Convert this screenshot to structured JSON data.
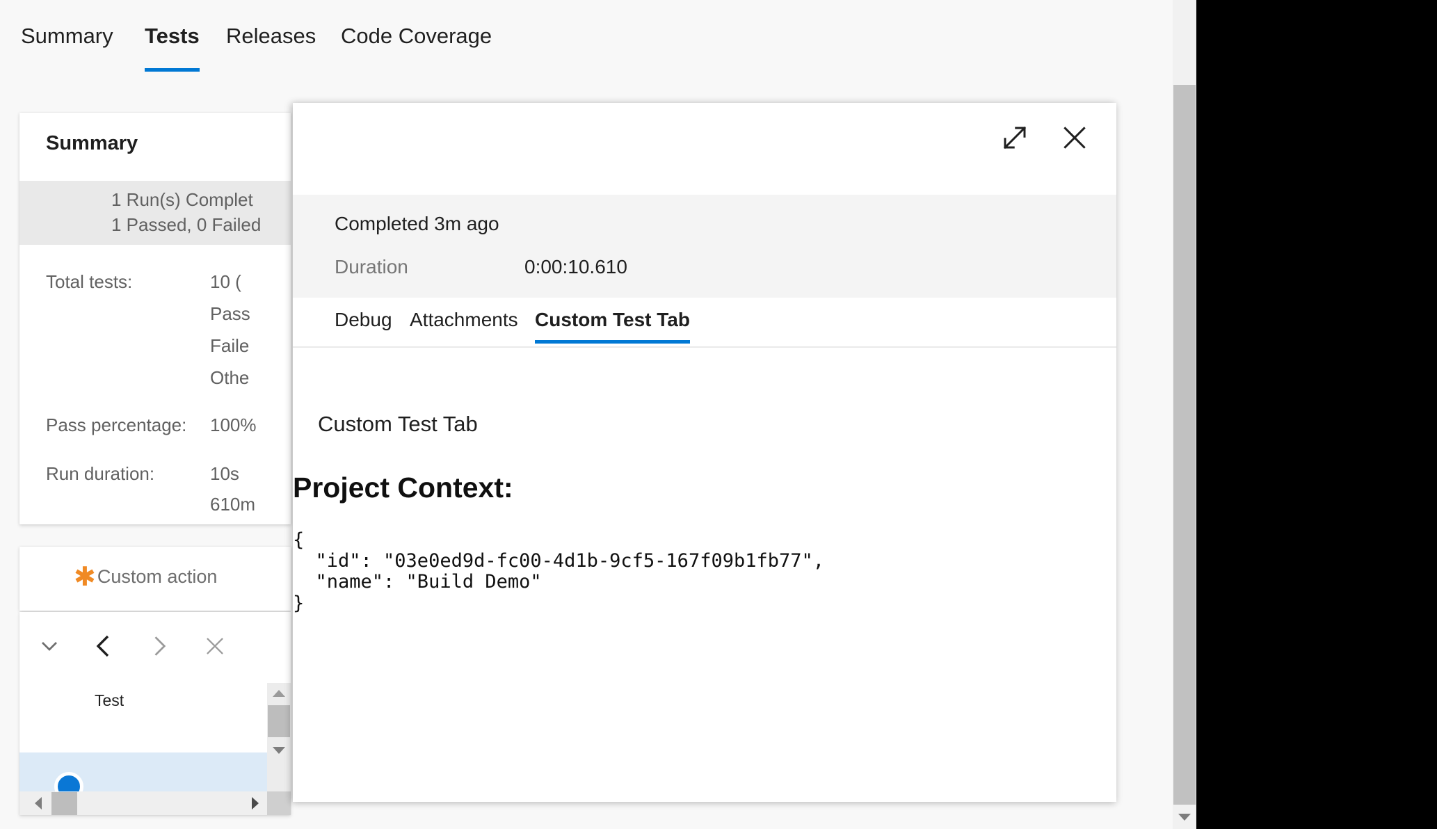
{
  "top_nav": {
    "tabs": [
      {
        "label": "Summary",
        "active": false
      },
      {
        "label": "Tests",
        "active": true
      },
      {
        "label": "Releases",
        "active": false
      },
      {
        "label": "Code Coverage",
        "active": false
      }
    ]
  },
  "summary_card": {
    "title": "Summary",
    "status_line_1": "1 Run(s) Complet",
    "status_line_2": "1 Passed, 0 Failed",
    "rows": [
      {
        "label": "Total tests:",
        "value": "10 ("
      },
      {
        "label": "",
        "value": "Pass"
      },
      {
        "label": "",
        "value": "Faile"
      },
      {
        "label": "",
        "value": "Othe"
      },
      {
        "label": "Pass percentage:",
        "value": "100%"
      },
      {
        "label": "Run duration:",
        "value": "10s"
      },
      {
        "label": "",
        "value": "610m"
      }
    ]
  },
  "custom_action": {
    "label": "Custom action",
    "icon": "asterisk-icon",
    "icon_color": "#f08a24"
  },
  "test_list": {
    "toolbar": [
      {
        "name": "chevron-down-icon"
      },
      {
        "name": "chevron-left-icon"
      },
      {
        "name": "chevron-right-icon"
      },
      {
        "name": "close-icon"
      }
    ],
    "column_header": "Test",
    "selected_row_status": "passed"
  },
  "detail_panel": {
    "header": {
      "expand_icon": "expand-diagonal-icon",
      "close_icon": "close-icon"
    },
    "completed": "Completed 3m ago",
    "duration_label": "Duration",
    "duration_value": "0:00:10.610",
    "tabs": [
      {
        "label": "Debug",
        "active": false
      },
      {
        "label": "Attachments",
        "active": false
      },
      {
        "label": "Custom Test Tab",
        "active": true
      }
    ],
    "content": {
      "subtitle": "Custom Test Tab",
      "heading": "Project Context:",
      "code": "{\n  \"id\": \"03e0ed9d-fc00-4d1b-9cf5-167f09b1fb77\",\n  \"name\": \"Build Demo\"\n}"
    }
  },
  "colors": {
    "accent_blue": "#0078d4",
    "selected_row": "#dceaf7",
    "status_circle": "#0a77d5"
  }
}
